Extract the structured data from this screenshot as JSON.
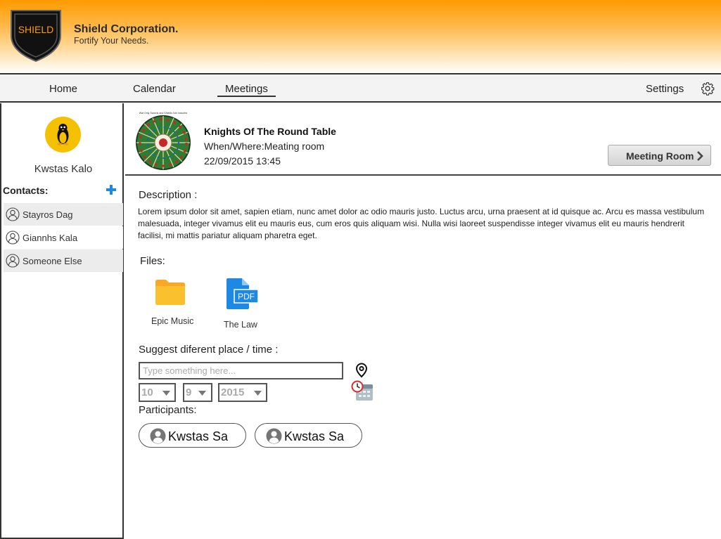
{
  "header": {
    "logo_text": "SHIELD",
    "company_name": "Shield Corporation.",
    "tagline": "Fortify Your Needs."
  },
  "nav": {
    "items": [
      {
        "label": "Home"
      },
      {
        "label": "Calendar"
      },
      {
        "label": "Meetings",
        "active": true
      }
    ],
    "settings_label": "Settings",
    "settings_icon": "gear-icon"
  },
  "sidebar": {
    "user_name": "Kwstas Kalo",
    "avatar_icon": "penguin-icon",
    "contacts_label": "Contacts:",
    "add_contact_icon": "plus-icon",
    "contacts": [
      {
        "name": "Stayros Dag"
      },
      {
        "name": "Giannhs Kala"
      },
      {
        "name": "Someone Else"
      }
    ]
  },
  "meeting": {
    "image_caption": "Wat Only Swords and Shields Not Included",
    "title": "Knights Of The Round Table",
    "where": "When/Where:Meating room",
    "when": "22/09/2015  13:45",
    "room_button_label": "Meeting Room"
  },
  "description": {
    "label": "Description :",
    "text": "Lorem ipsum dolor sit amet, sapien etiam, nunc amet dolor ac odio mauris justo. Luctus arcu, urna praesent at id quisque ac. Arcu es massa vestibulum malesuada, integer vivamus elit eu mauris eus, cum eros quis aliquam wisi. Nulla wisi laoreet suspendisse integer vivamus elit eu mauris hendrerit facilisi, mi mattis pariatur aliquam pharetra eget."
  },
  "files": {
    "label": "Files:",
    "items": [
      {
        "name": "Epic Music",
        "icon": "folder-icon"
      },
      {
        "name": "The Law",
        "icon": "pdf-icon",
        "badge": "PDF"
      }
    ]
  },
  "suggest": {
    "label": "Suggest diferent place / time :",
    "placeholder": "Type something here...",
    "value": "",
    "day": "10",
    "month": "9",
    "year": "2015"
  },
  "participants": {
    "label": "Participants:",
    "items": [
      {
        "name": "Kwstas Sa"
      },
      {
        "name": "Kwstas Sa"
      }
    ]
  },
  "colors": {
    "header_orange": "#ff9a00",
    "avatar_yellow": "#f5c000",
    "accent_blue": "#1e88e5",
    "folder_yellow": "#fbc02d"
  }
}
